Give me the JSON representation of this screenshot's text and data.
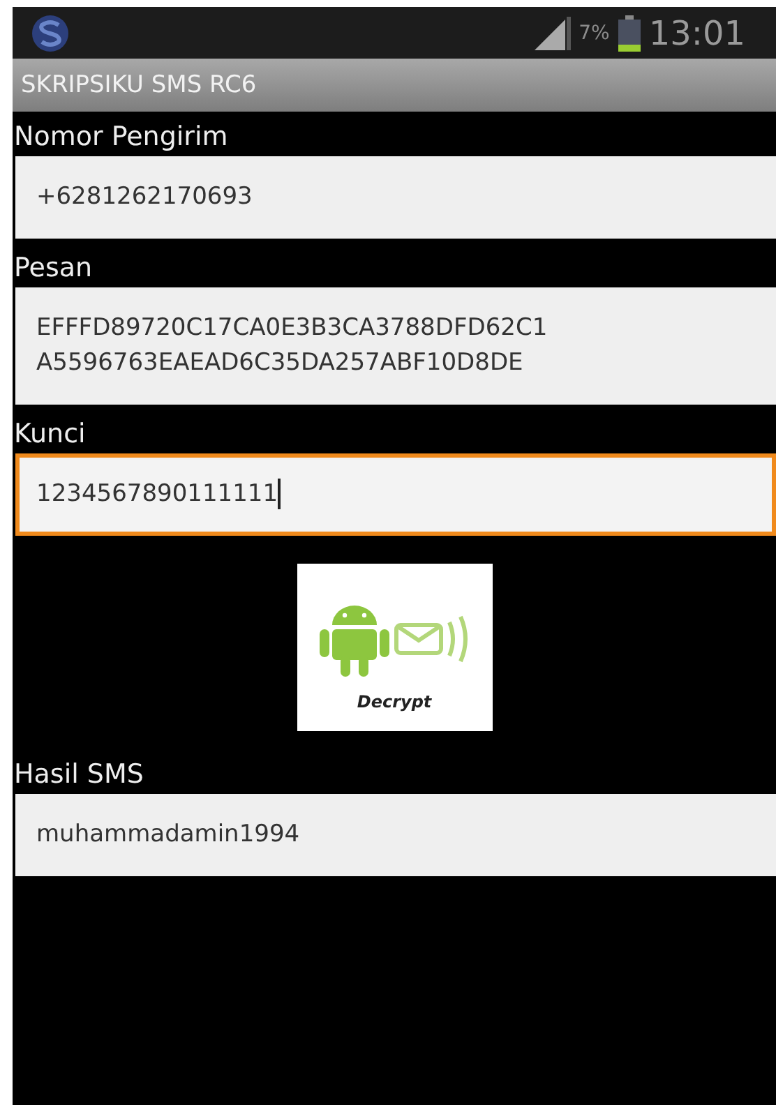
{
  "status_bar": {
    "battery": "7%",
    "time": "13:01"
  },
  "title_bar": {
    "title": "SKRIPSIKU SMS RC6"
  },
  "fields": [
    {
      "label": "Nomor Pengirim",
      "value": "+6281262170693",
      "focused": false
    },
    {
      "label": "Pesan",
      "value": "EFFFD89720C17CA0E3B3CA3788DFD62C1 A5596763EAEAD6C35DA257ABF10D8DE",
      "focused": false
    },
    {
      "label": "Kunci",
      "value": "1234567890111111",
      "focused": true
    }
  ],
  "decrypt_button": {
    "label": "Decrypt"
  },
  "result": {
    "label": "Hasil SMS",
    "value": "muhammadamin1994",
    "focused": false
  }
}
